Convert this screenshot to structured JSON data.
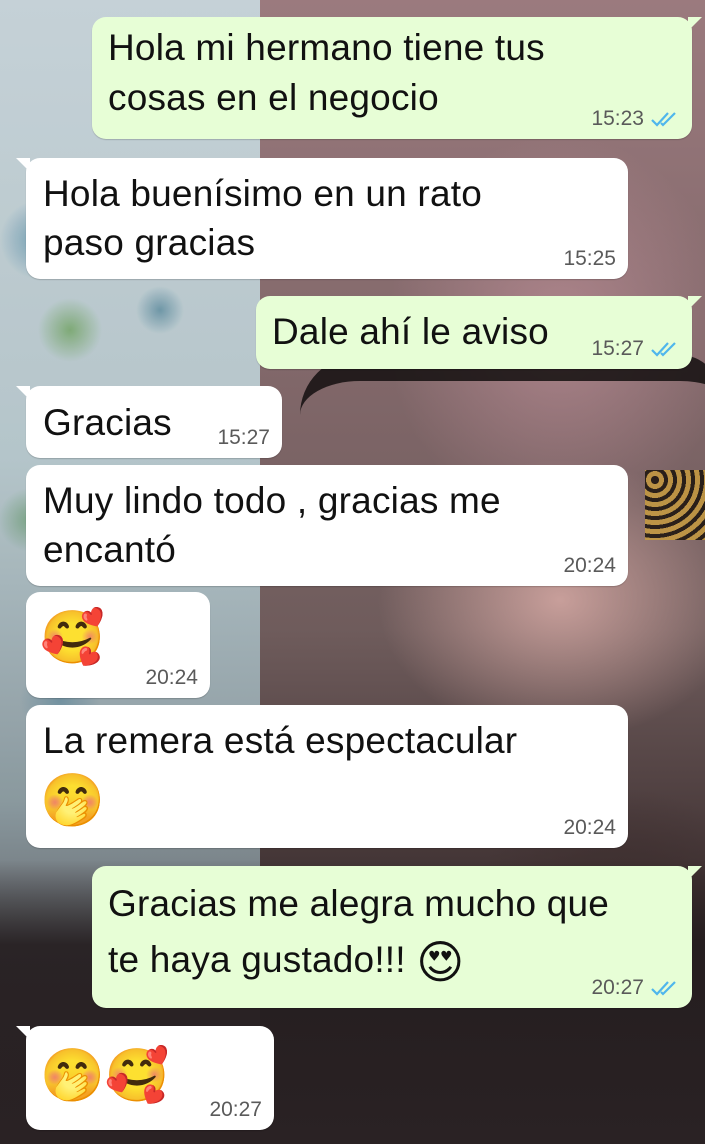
{
  "chat": {
    "messages": [
      {
        "dir": "out",
        "text_lines": [
          "Hola mi hermano tiene tus",
          "cosas en el negocio"
        ],
        "time": "15:23",
        "status": "read"
      },
      {
        "dir": "in",
        "text_lines": [
          "Hola buenísimo en un rato",
          "paso gracias"
        ],
        "time": "15:25"
      },
      {
        "dir": "out",
        "text_lines": [
          "Dale ahí le aviso"
        ],
        "time": "15:27",
        "status": "read"
      },
      {
        "dir": "in",
        "text_lines": [
          "Gracias"
        ],
        "time": "15:27"
      },
      {
        "dir": "in",
        "text_lines": [
          "Muy lindo todo , gracias me",
          "encantó"
        ],
        "time": "20:24"
      },
      {
        "dir": "in",
        "emoji": "🥰",
        "time": "20:24"
      },
      {
        "dir": "in",
        "text_lines": [
          "La remera está espectacular"
        ],
        "emoji": "🤭",
        "time": "20:24"
      },
      {
        "dir": "out",
        "text_lines": [
          "Gracias me alegra mucho que",
          "te haya gustado!!!"
        ],
        "emoji": "😍",
        "time": "20:27",
        "status": "read"
      },
      {
        "dir": "in",
        "emoji": "🤭🥰",
        "time": "20:27"
      }
    ]
  },
  "icons": {
    "read_receipt": "double-check-icon"
  },
  "colors": {
    "incoming_bubble": "#ffffff",
    "outgoing_bubble": "#e7fed6",
    "read_tick": "#4fb6ec"
  }
}
